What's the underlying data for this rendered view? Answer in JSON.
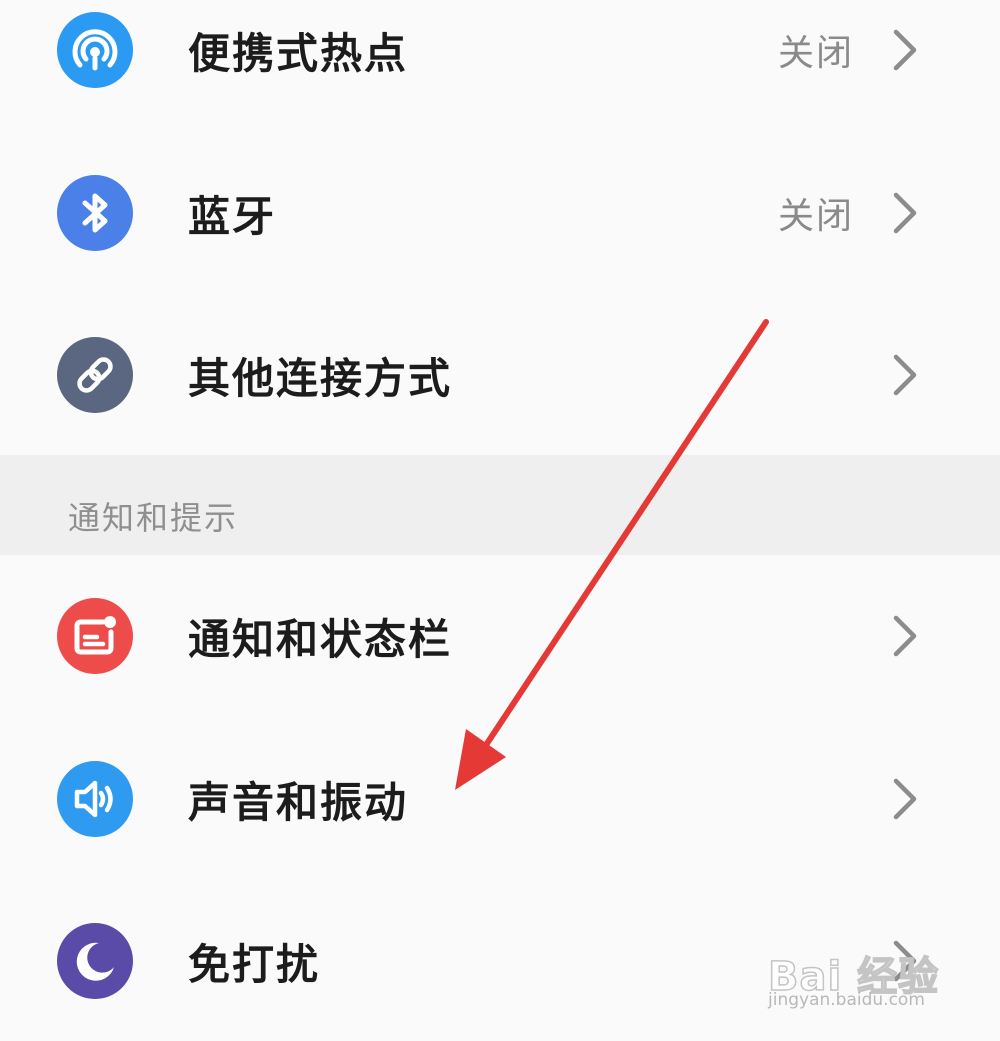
{
  "connections": {
    "items": [
      {
        "icon": "hotspot-icon",
        "label": "便携式热点",
        "status": "关闭",
        "color": "#2b9af3"
      },
      {
        "icon": "bluetooth-icon",
        "label": "蓝牙",
        "status": "关闭",
        "color": "#4a80e8"
      },
      {
        "icon": "link-icon",
        "label": "其他连接方式",
        "status": "",
        "color": "#5b6780"
      }
    ]
  },
  "notifications_section": {
    "title": "通知和提示",
    "items": [
      {
        "icon": "notification-icon",
        "label": "通知和状态栏",
        "color": "#ee4b4b"
      },
      {
        "icon": "speaker-icon",
        "label": "声音和振动",
        "color": "#2f9bf0"
      },
      {
        "icon": "moon-icon",
        "label": "免打扰",
        "color": "#5a4ba8"
      }
    ]
  },
  "annotation": {
    "arrow_color": "#e53935"
  },
  "watermark": {
    "brand": "Bai 经验",
    "url": "jingyan.baidu.com"
  }
}
